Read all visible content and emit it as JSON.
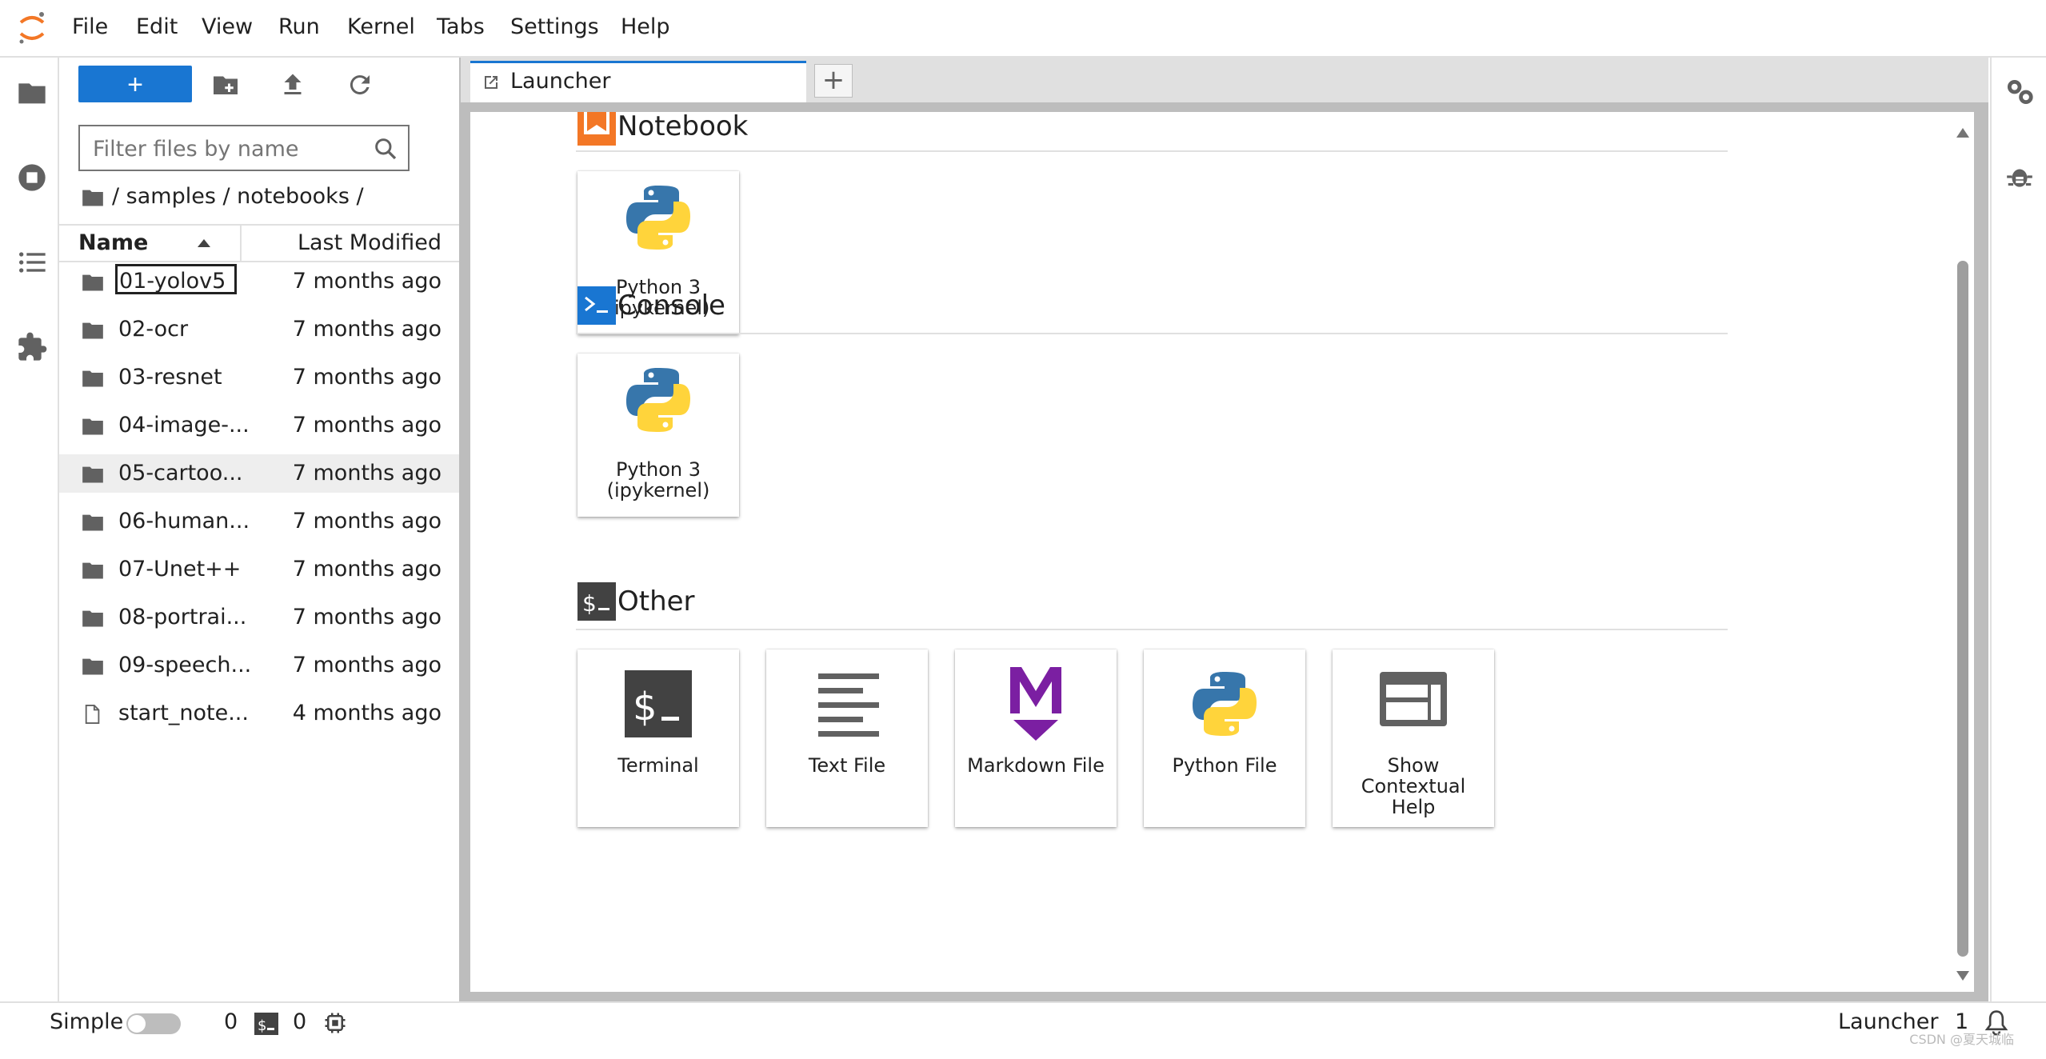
{
  "menu": {
    "items": [
      "File",
      "Edit",
      "View",
      "Run",
      "Kernel",
      "Tabs",
      "Settings",
      "Help"
    ]
  },
  "filebrowser": {
    "new_button_label": "+",
    "filter_placeholder": "Filter files by name",
    "breadcrumb": "/ samples / notebooks /",
    "columns": {
      "name": "Name",
      "modified": "Last Modified"
    },
    "files": [
      {
        "name": "01-yolov5",
        "modified": "7 months ago",
        "type": "folder"
      },
      {
        "name": "02-ocr",
        "modified": "7 months ago",
        "type": "folder"
      },
      {
        "name": "03-resnet",
        "modified": "7 months ago",
        "type": "folder"
      },
      {
        "name": "04-image-...",
        "modified": "7 months ago",
        "type": "folder"
      },
      {
        "name": "05-cartoo...",
        "modified": "7 months ago",
        "type": "folder"
      },
      {
        "name": "06-human...",
        "modified": "7 months ago",
        "type": "folder"
      },
      {
        "name": "07-Unet++",
        "modified": "7 months ago",
        "type": "folder"
      },
      {
        "name": "08-portrai...",
        "modified": "7 months ago",
        "type": "folder"
      },
      {
        "name": "09-speech...",
        "modified": "7 months ago",
        "type": "folder"
      },
      {
        "name": "start_note...",
        "modified": "4 months ago",
        "type": "file"
      }
    ]
  },
  "tabs": {
    "active_label": "Launcher",
    "add_label": "+"
  },
  "launcher": {
    "notebook": {
      "title": "Notebook",
      "cards": [
        {
          "line1": "Python 3",
          "line2": "(ipykernel)"
        }
      ]
    },
    "console": {
      "title": "Console",
      "cards": [
        {
          "line1": "Python 3",
          "line2": "(ipykernel)"
        }
      ]
    },
    "other": {
      "title": "Other",
      "cards": [
        {
          "line1": "Terminal"
        },
        {
          "line1": "Text File"
        },
        {
          "line1": "Markdown File"
        },
        {
          "line1": "Python File"
        },
        {
          "line1": "Show",
          "line2": "Contextual",
          "line3": "Help"
        }
      ]
    }
  },
  "statusbar": {
    "simple_label": "Simple",
    "kernels_count": "0",
    "terminals_count": "0",
    "mode_label": "Launcher",
    "notifications_count": "1",
    "watermark": "CSDN @夏天城临"
  },
  "colors": {
    "accent": "#1976d2",
    "notebook_icon": "#f37726",
    "console_icon": "#1976d2",
    "markdown_icon": "#7b1fa2"
  }
}
